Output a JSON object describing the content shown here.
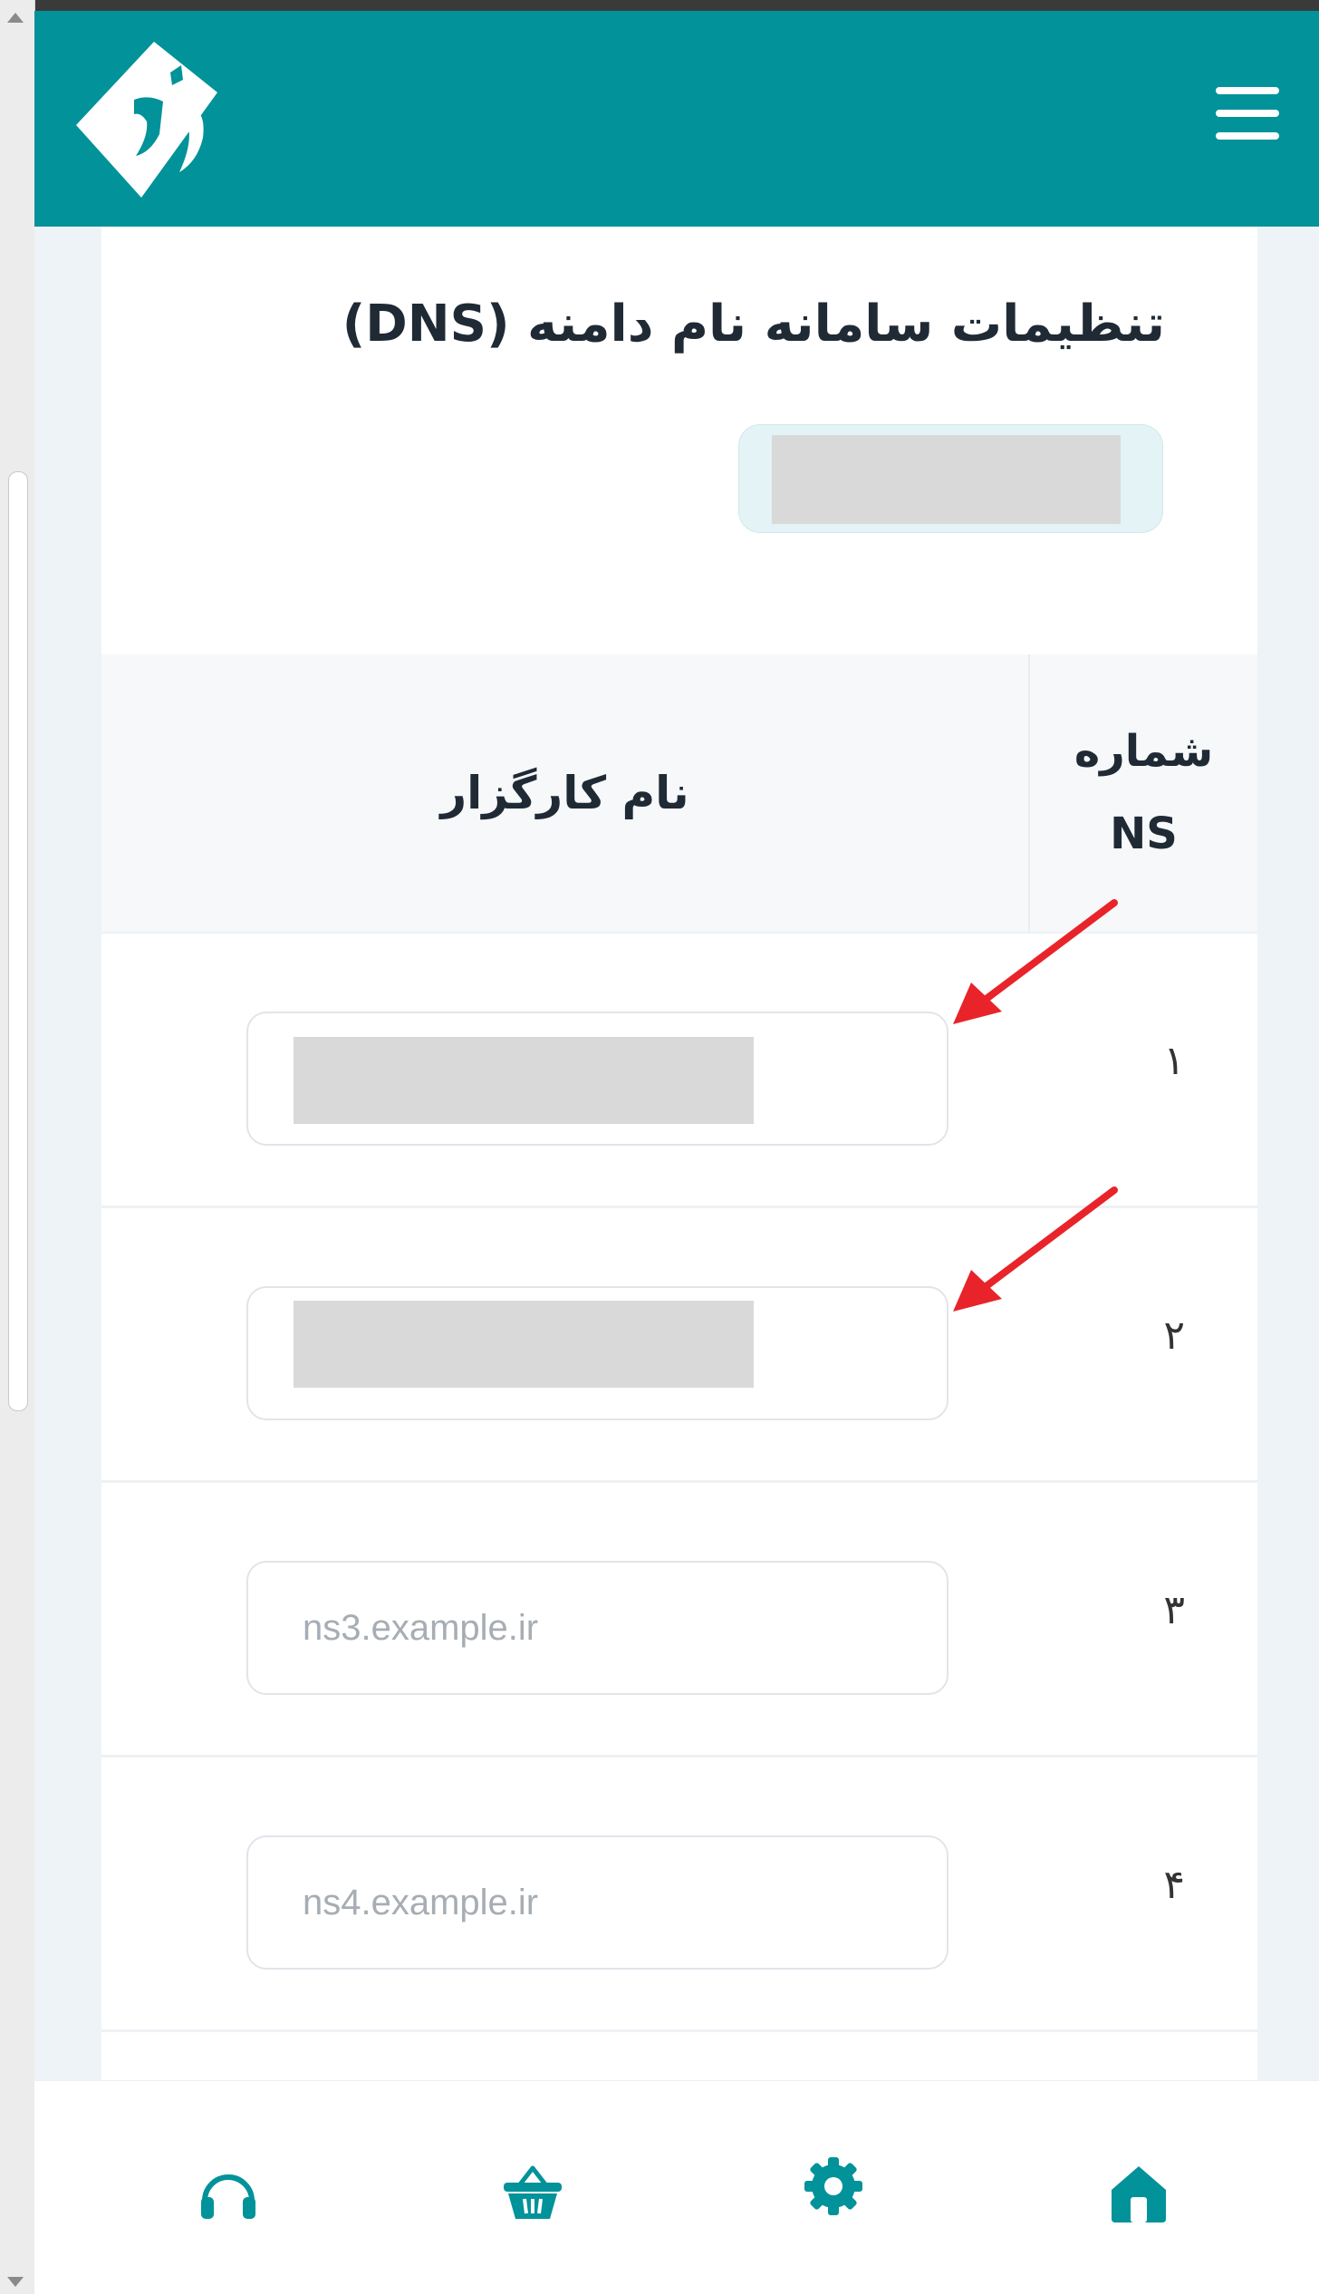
{
  "header": {
    "logo": "logo-icon",
    "menu_icon": "hamburger-menu-icon",
    "brand_color": "#01929a"
  },
  "page": {
    "title": "تنظیمات سامانه نام دامنه (DNS)"
  },
  "table": {
    "headers": {
      "ns_number_line1": "شماره",
      "ns_number_line2": "NS",
      "server_name": "نام کارگزار"
    },
    "rows": [
      {
        "number": "۱",
        "value": "",
        "placeholder": ""
      },
      {
        "number": "۲",
        "value": "",
        "placeholder": ""
      },
      {
        "number": "۳",
        "value": "",
        "placeholder": "ns3.example.ir"
      },
      {
        "number": "۴",
        "value": "",
        "placeholder": "ns4.example.ir"
      }
    ]
  },
  "annotations": {
    "arrow_color": "#e8242a"
  },
  "bottom_nav": {
    "items": [
      {
        "icon": "headphones-icon"
      },
      {
        "icon": "basket-icon"
      },
      {
        "icon": "gear-icon"
      },
      {
        "icon": "home-icon"
      }
    ],
    "icon_color": "#01929a"
  }
}
